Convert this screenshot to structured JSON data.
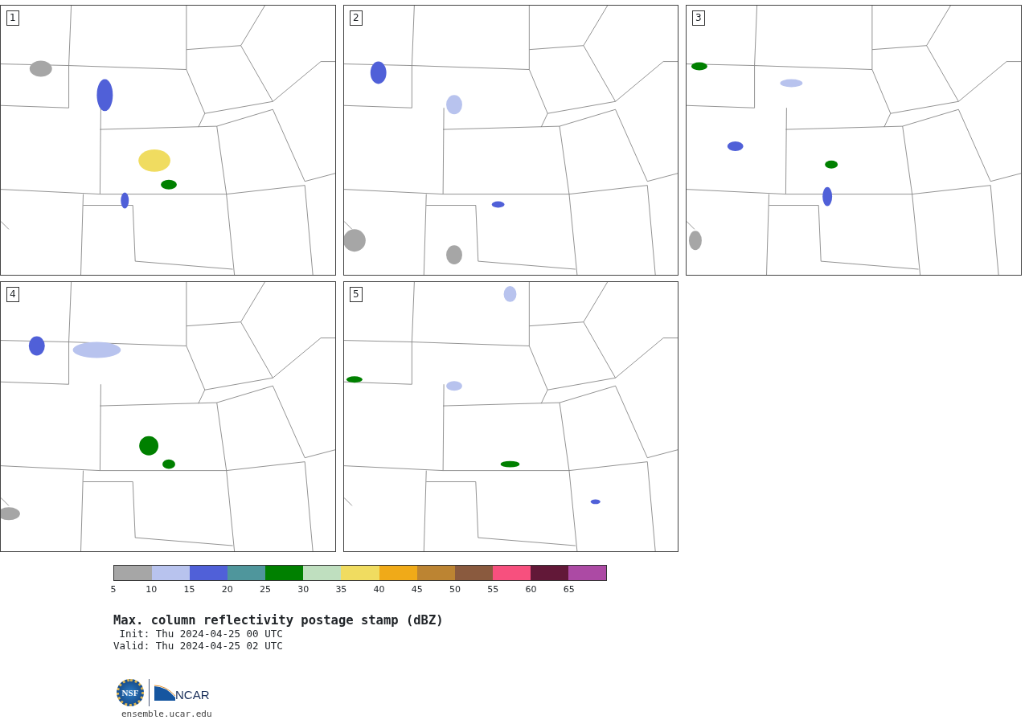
{
  "panels": [
    {
      "label": "1"
    },
    {
      "label": "2"
    },
    {
      "label": "3"
    },
    {
      "label": "4"
    },
    {
      "label": "5"
    }
  ],
  "colorbar": {
    "bins": [
      {
        "color": "#a6a6a6"
      },
      {
        "color": "#b8c3ee"
      },
      {
        "color": "#5060d8"
      },
      {
        "color": "#4f969c"
      },
      {
        "color": "#008000"
      },
      {
        "color": "#bfdfbf"
      },
      {
        "color": "#f0dc60"
      },
      {
        "color": "#f0aa18"
      },
      {
        "color": "#bc8432"
      },
      {
        "color": "#8a5a3e"
      },
      {
        "color": "#f7507e"
      },
      {
        "color": "#621838"
      },
      {
        "color": "#ac4aa4"
      }
    ],
    "ticks": [
      "5",
      "10",
      "15",
      "20",
      "25",
      "30",
      "35",
      "40",
      "45",
      "50",
      "55",
      "60",
      "65"
    ]
  },
  "title": "Max. column reflectivity postage stamp (dBZ)",
  "init": " Init: Thu 2024-04-25 00 UTC",
  "valid": "Valid: Thu 2024-04-25 02 UTC",
  "logos": [
    {
      "text": "NSF"
    },
    {
      "text": "NCAR"
    }
  ],
  "url": "ensemble.ucar.edu"
}
